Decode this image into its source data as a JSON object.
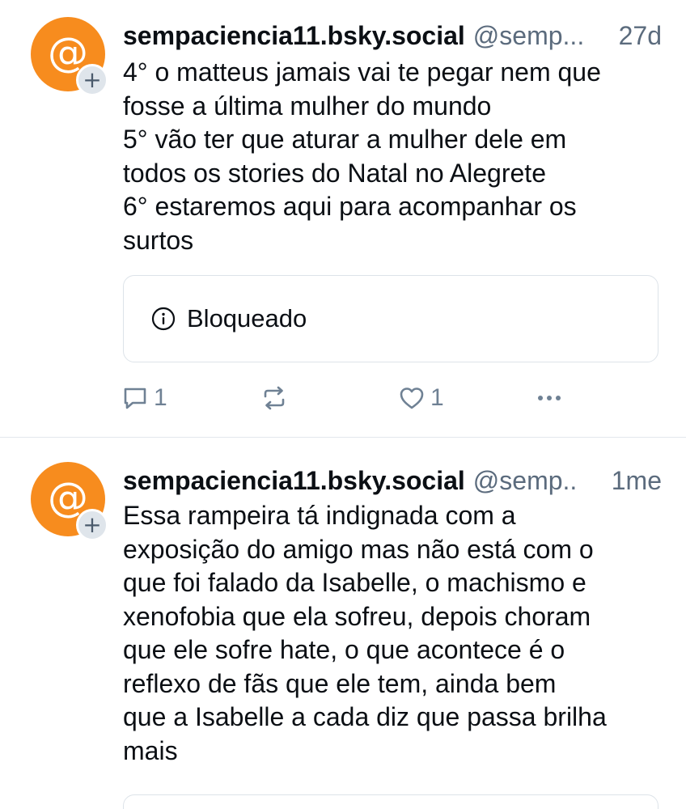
{
  "colors": {
    "avatar_bg": "#f78c1e",
    "muted_text": "#5b6b7d",
    "action_icon": "#6f8194",
    "border": "#dde3e9"
  },
  "posts": [
    {
      "avatar": {
        "icon": "at-sign-icon",
        "glyph": "@",
        "badge_icon": "plus-icon",
        "badge_glyph": "+"
      },
      "display_name": "sempaciencia11.bsky.social",
      "handle": "@semp...",
      "timestamp": "27d",
      "lines": [
        "4° o matteus jamais vai te pegar nem que",
        "fosse a última mulher do mundo",
        "5° vão ter que aturar a mulher dele em",
        "todos os stories do Natal no Alegrete",
        "6° estaremos aqui para acompanhar os",
        "surtos"
      ],
      "embed": {
        "icon": "info-circle-icon",
        "label": "Bloqueado"
      },
      "actions": {
        "reply_count": "1",
        "repost_count": "",
        "like_count": "1"
      }
    },
    {
      "avatar": {
        "icon": "at-sign-icon",
        "glyph": "@",
        "badge_icon": "plus-icon",
        "badge_glyph": "+"
      },
      "display_name": "sempaciencia11.bsky.social",
      "handle": "@semp..",
      "timestamp": "1me",
      "lines": [
        "Essa rampeira tá indignada com a",
        "exposição do amigo mas não está com o",
        "que foi falado da Isabelle, o machismo e",
        "xenofobia que ela sofreu, depois choram",
        "que ele sofre hate, o que acontece é o",
        "reflexo de fãs que ele tem, ainda bem",
        "que a Isabelle a cada diz que passa brilha",
        "mais"
      ]
    }
  ]
}
